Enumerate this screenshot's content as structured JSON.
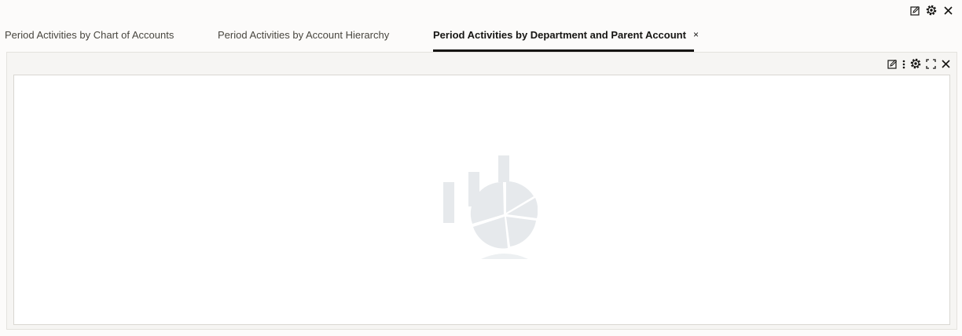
{
  "window_tools": {
    "icons": [
      "edit-icon",
      "settings-icon",
      "close-icon"
    ]
  },
  "tabs": [
    {
      "label": "Period Activities by Chart of Accounts",
      "active": false
    },
    {
      "label": "Period Activities by Account Hierarchy",
      "active": false
    },
    {
      "label": "Period Activities by Department and Parent Account",
      "active": true,
      "close_glyph": "×"
    }
  ],
  "panel_tools": {
    "icons": [
      "edit-icon",
      "more-vertical-icon",
      "settings-icon",
      "fullscreen-icon",
      "close-icon"
    ]
  },
  "chart_placeholder": {
    "icon": "chart-placeholder-icon",
    "color": "#e6e9ec"
  }
}
